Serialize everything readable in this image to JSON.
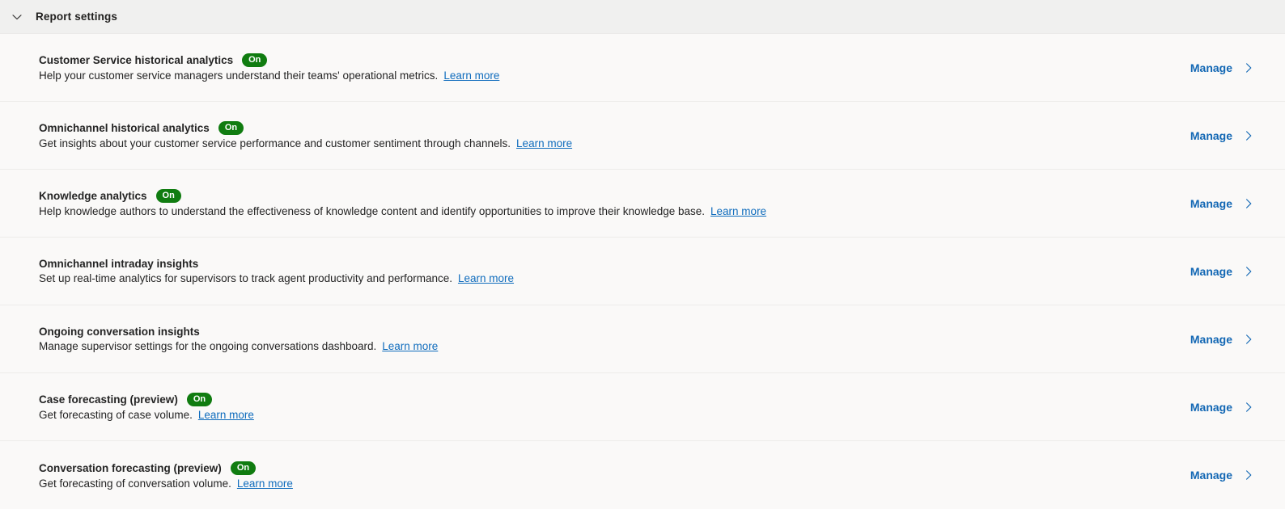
{
  "section": {
    "title": "Report settings",
    "expanded": true,
    "collapse_icon": "chevron-down-icon"
  },
  "colors": {
    "badge_on": "#107c10",
    "link": "#0f6cbd",
    "manage_link": "#1267b4",
    "header_background": "#f0f0ef",
    "page_background": "#faf9f8",
    "divider": "#edecea"
  },
  "action": {
    "manage_label": "Manage",
    "chevron_icon": "chevron-right-icon"
  },
  "rows": [
    {
      "title": "Customer Service historical analytics",
      "badge": "On",
      "description": "Help your customer service managers understand their teams' operational metrics.",
      "link_label": "Learn more",
      "manage_label": "Manage"
    },
    {
      "title": "Omnichannel historical analytics",
      "badge": "On",
      "description": "Get insights about your customer service performance and customer sentiment through channels.",
      "link_label": "Learn more",
      "manage_label": "Manage"
    },
    {
      "title": "Knowledge analytics",
      "badge": "On",
      "description": "Help knowledge authors to understand the effectiveness of knowledge content and identify opportunities to improve their knowledge base.",
      "link_label": "Learn more",
      "manage_label": "Manage"
    },
    {
      "title": "Omnichannel intraday insights",
      "badge": "",
      "description": "Set up real-time analytics for supervisors to track agent productivity and performance.",
      "link_label": "Learn more",
      "manage_label": "Manage"
    },
    {
      "title": "Ongoing conversation insights",
      "badge": "",
      "description": "Manage supervisor settings for the ongoing conversations dashboard.",
      "link_label": "Learn more",
      "manage_label": "Manage"
    },
    {
      "title": "Case forecasting (preview)",
      "badge": "On",
      "description": "Get forecasting of case volume.",
      "link_label": "Learn more",
      "manage_label": "Manage"
    },
    {
      "title": "Conversation forecasting (preview)",
      "badge": "On",
      "description": "Get forecasting of conversation volume.",
      "link_label": "Learn more",
      "manage_label": "Manage"
    }
  ]
}
